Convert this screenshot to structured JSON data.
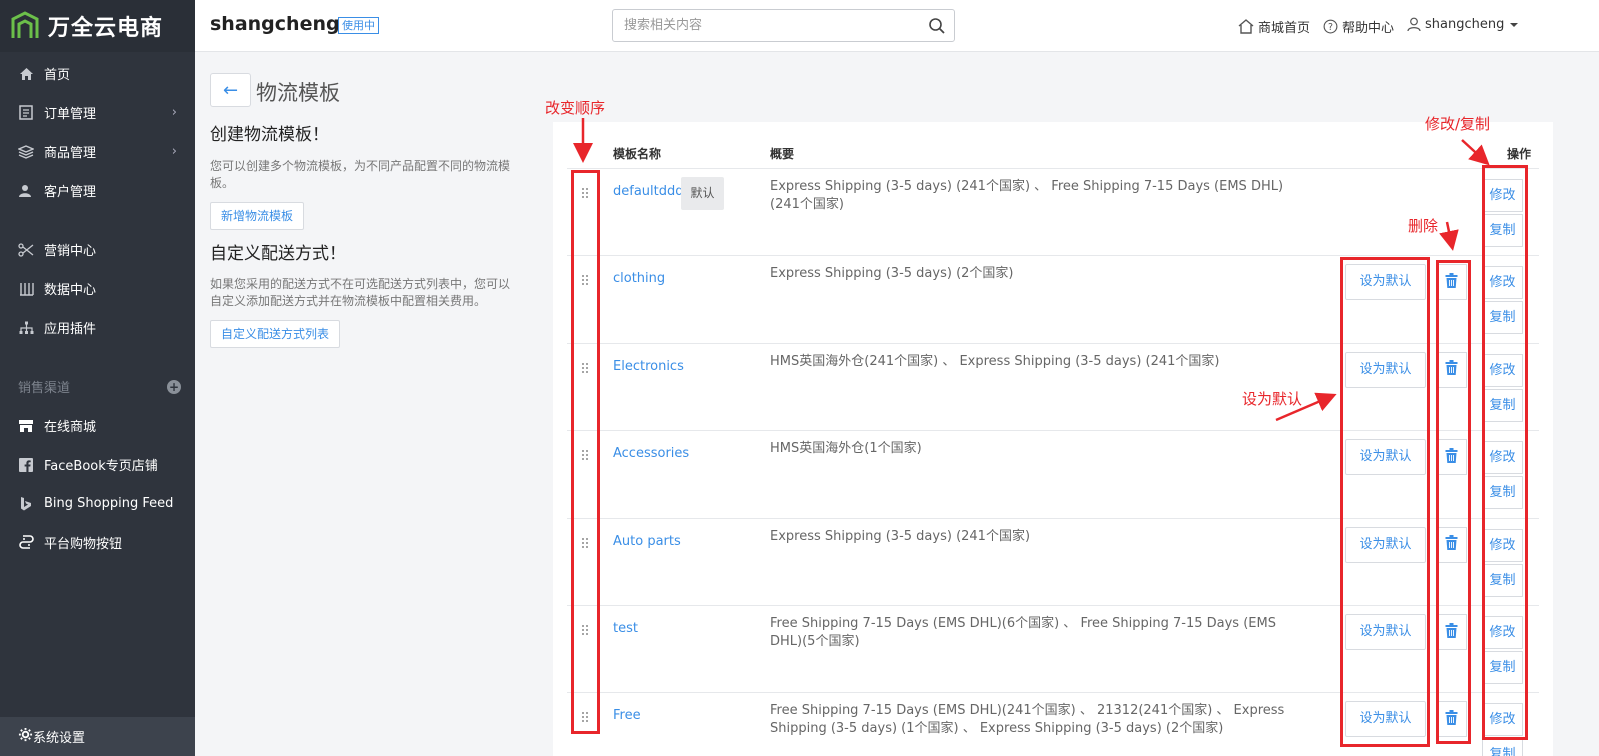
{
  "brand": {
    "name": "万全云电商"
  },
  "sidebar": {
    "items": [
      {
        "label": "首页",
        "icon": "home-icon"
      },
      {
        "label": "订单管理",
        "icon": "order-icon",
        "has_arrow": true
      },
      {
        "label": "商品管理",
        "icon": "product-icon",
        "has_arrow": true
      },
      {
        "label": "客户管理",
        "icon": "customer-icon"
      },
      {
        "label": "营销中心",
        "icon": "marketing-icon"
      },
      {
        "label": "数据中心",
        "icon": "data-icon"
      },
      {
        "label": "应用插件",
        "icon": "plugin-icon"
      }
    ],
    "section_label": "销售渠道",
    "channels": [
      {
        "label": "在线商城",
        "icon": "store-icon"
      },
      {
        "label": "FaceBook专页店铺",
        "icon": "facebook-icon"
      },
      {
        "label": "Bing Shopping Feed",
        "icon": "bing-icon"
      },
      {
        "label": "平台购物按钮",
        "icon": "cart-button-icon"
      }
    ],
    "bottom_item": {
      "label": "系统设置",
      "icon": "gear-icon"
    },
    "arrow_glyph": "›",
    "plus_glyph": "+"
  },
  "header": {
    "shop_name": "shangcheng",
    "status_badge": "使用中",
    "search_placeholder": "搜索相关内容",
    "links": {
      "home": "商城首页",
      "help": "帮助中心",
      "user": "shangcheng"
    }
  },
  "page": {
    "back_arrow": "←",
    "title": "物流模板",
    "create_title": "创建物流模板！",
    "create_desc": "您可以创建多个物流模板，为不同产品配置不同的物流模板。",
    "create_button": "新增物流模板",
    "custom_title": "自定义配送方式！",
    "custom_desc": "如果您采用的配送方式不在可选配送方式列表中，您可以自定义添加配送方式并在物流模板中配置相关费用。",
    "custom_button": "自定义配送方式列表"
  },
  "table": {
    "headers": {
      "name": "模板名称",
      "summary": "概要",
      "actions": "操作"
    },
    "default_tag": "默认",
    "set_default_label": "设为默认",
    "edit_label": "修改",
    "copy_label": "复制",
    "rows": [
      {
        "name": "defaultddd",
        "summary": "Express Shipping (3-5 days) (241个国家) 、 Free Shipping 7-15 Days (EMS DHL)(241个国家)",
        "is_default": true
      },
      {
        "name": "clothing",
        "summary": "Express Shipping (3-5 days) (2个国家)",
        "is_default": false
      },
      {
        "name": "Electronics",
        "summary": "HMS英国海外仓(241个国家) 、 Express Shipping (3-5 days) (241个国家)",
        "is_default": false
      },
      {
        "name": "Accessories",
        "summary": "HMS英国海外仓(1个国家)",
        "is_default": false
      },
      {
        "name": "Auto parts",
        "summary": "Express Shipping (3-5 days) (241个国家)",
        "is_default": false
      },
      {
        "name": "test",
        "summary": "Free Shipping 7-15 Days (EMS DHL)(6个国家) 、 Free Shipping 7-15 Days (EMS DHL)(5个国家)",
        "is_default": false
      },
      {
        "name": "Free",
        "summary": "Free Shipping 7-15 Days (EMS DHL)(241个国家) 、 21312(241个国家) 、 Express Shipping (3-5 days) (1个国家) 、 Express Shipping (3-5 days) (2个国家)",
        "is_default": false
      }
    ]
  },
  "annotations": {
    "reorder": "改变顺序",
    "edit_copy": "修改/复制",
    "delete": "删除",
    "set_default": "设为默认",
    "color": "#e8262b"
  },
  "colors": {
    "sidebar_bg": "#2f343d",
    "accent": "#3a8ee6",
    "annotation": "#e8262b"
  }
}
